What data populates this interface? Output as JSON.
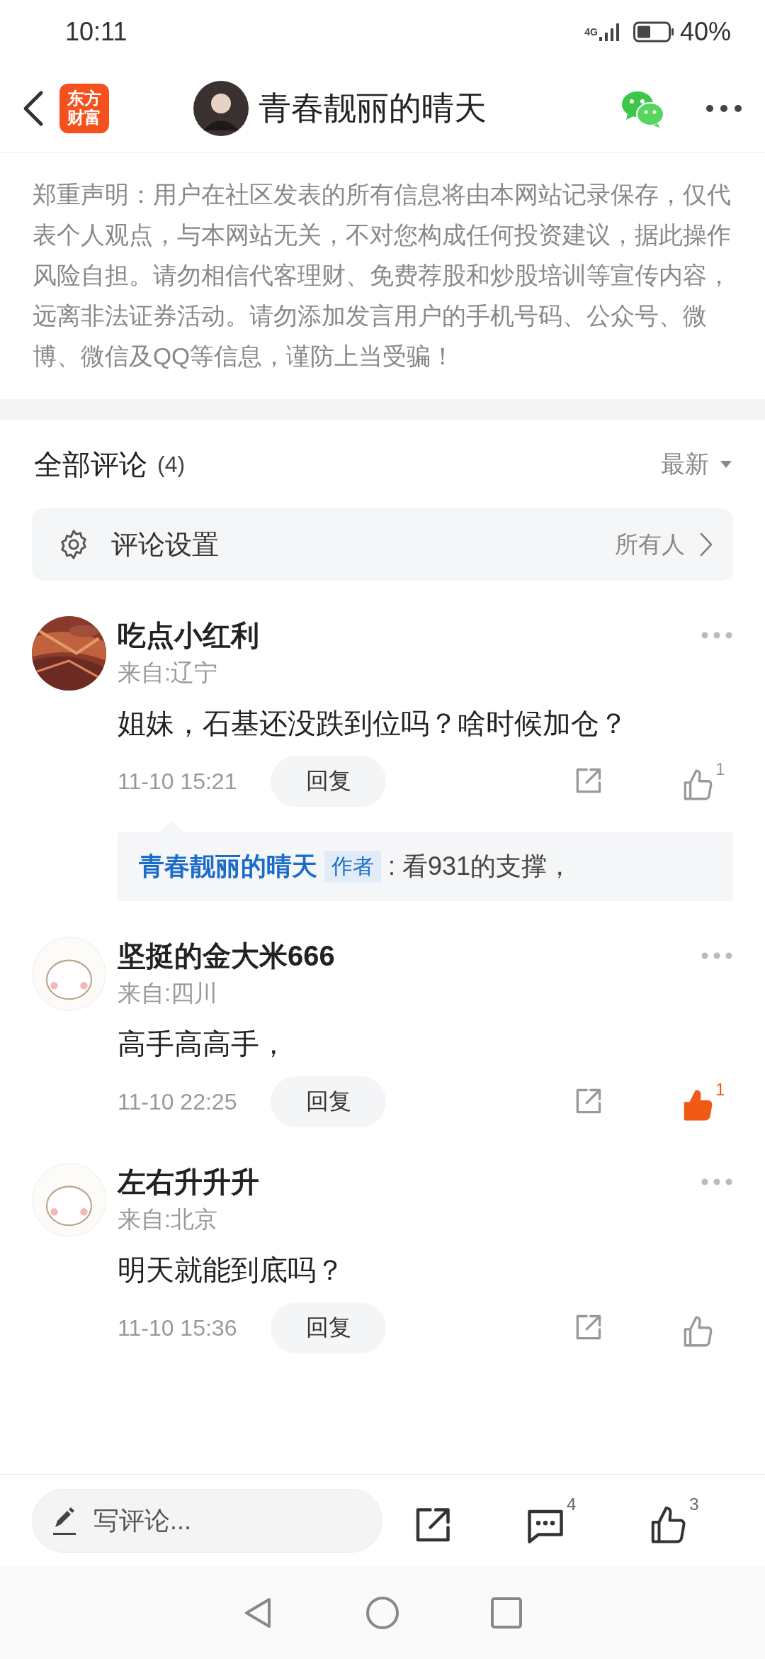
{
  "status_bar": {
    "time": "10:11",
    "network": "4G",
    "battery": "40%"
  },
  "header": {
    "logo": [
      "东方",
      "财富"
    ],
    "title": "青春靓丽的晴天"
  },
  "disclaimer": "郑重声明：用户在社区发表的所有信息将由本网站记录保存，仅代表个人观点，与本网站无关，不对您构成任何投资建议，据此操作风险自担。请勿相信代客理财、免费荐股和炒股培训等宣传内容，远离非法证券活动。请勿添加发言用户的手机号码、公众号、微博、微信及QQ等信息，谨防上当受骗！",
  "comments_header": {
    "title": "全部评论",
    "count": "(4)",
    "sort": "最新"
  },
  "comment_settings": {
    "label": "评论设置",
    "value": "所有人"
  },
  "comments": [
    {
      "name": "吃点小红利",
      "location": "来自:辽宁",
      "text": "姐妹，石基还没跌到位吗？啥时候加仓？",
      "time": "11-10 15:21",
      "reply_button": "回复",
      "liked": false,
      "likes": "1",
      "reply": {
        "author": "青春靓丽的晴天",
        "tag": "作者",
        "text": ": 看931的支撑，"
      }
    },
    {
      "avatar": {
        "kind": "icon"
      },
      "name": "坚挺的金大米666",
      "location": "来自:四川",
      "text": "高手高高手，",
      "time": "11-10 22:25",
      "reply_button": "回复",
      "liked": true,
      "likes": "1"
    },
    {
      "avatar": {
        "kind": "icon"
      },
      "name": "左右升升升",
      "location": "来自:北京",
      "text": "明天就能到底吗？",
      "time": "11-10 15:36",
      "reply_button": "回复",
      "liked": false
    }
  ],
  "bottom_bar": {
    "placeholder": "写评论...",
    "comment_count": "4",
    "like_count": "3"
  }
}
